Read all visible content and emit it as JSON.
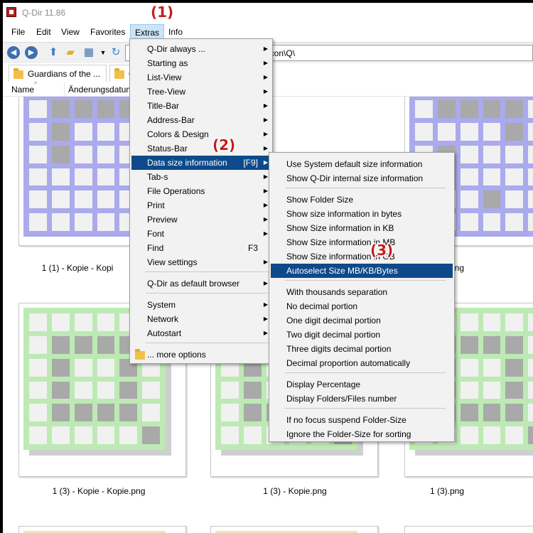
{
  "window": {
    "title": "Q-Dir 11.86"
  },
  "menubar": {
    "items": [
      "File",
      "Edit",
      "View",
      "Favorites",
      "Extras",
      "Info"
    ]
  },
  "address": {
    "path": "g\\icon\\Q\\"
  },
  "tabs": [
    {
      "label": "Guardians of the ..."
    },
    {
      "label": "C"
    }
  ],
  "columns": {
    "name": "Name",
    "date": "Änderungsdatum"
  },
  "thumbnails": [
    {
      "caption": "1 (1) - Kopie - Kopi",
      "color": "#aaaaec"
    },
    {
      "caption": "",
      "color": "#aaaaec"
    },
    {
      "caption": "1 (1).png",
      "color": "#aaaaec"
    },
    {
      "caption": "1 (3) - Kopie - Kopie.png",
      "color": "#bdeab4"
    },
    {
      "caption": "1 (3) - Kopie.png",
      "color": "#bdeab4"
    },
    {
      "caption": "1 (3).png",
      "color": "#bdeab4"
    }
  ],
  "extras_menu": {
    "items": [
      {
        "label": "Q-Dir always ...",
        "submenu": true
      },
      {
        "label": "Starting as",
        "submenu": true
      },
      {
        "label": "List-View",
        "submenu": true
      },
      {
        "label": "Tree-View",
        "submenu": true
      },
      {
        "label": "Title-Bar",
        "submenu": true
      },
      {
        "label": "Address-Bar",
        "submenu": true
      },
      {
        "label": "Colors & Design",
        "submenu": true
      },
      {
        "label": "Status-Bar",
        "submenu": true
      },
      {
        "label": "Data size information",
        "shortcut": "[F9]",
        "submenu": true,
        "highlighted": true
      },
      {
        "label": "Tab-s",
        "submenu": true
      },
      {
        "label": "File Operations",
        "submenu": true
      },
      {
        "label": "Print",
        "submenu": true
      },
      {
        "label": "Preview",
        "submenu": true
      },
      {
        "label": "Font",
        "submenu": true
      },
      {
        "label": "Find",
        "shortcut": "F3"
      },
      {
        "label": "View settings",
        "submenu": true
      },
      {
        "label": "Q-Dir as default browser",
        "submenu": true
      },
      {
        "label": "System",
        "submenu": true
      },
      {
        "label": "Network",
        "submenu": true
      },
      {
        "label": "Autostart",
        "submenu": true
      },
      {
        "label": "... more options"
      }
    ]
  },
  "size_menu": {
    "items": [
      {
        "label": "Use System default size information"
      },
      {
        "label": "Show Q-Dir internal size information"
      },
      {
        "label": "Show Folder Size"
      },
      {
        "label": "Show size information in bytes"
      },
      {
        "label": "Show Size information in KB"
      },
      {
        "label": "Show Size information in MB"
      },
      {
        "label": "Show Size information in GB"
      },
      {
        "label": "Autoselect Size MB/KB/Bytes",
        "highlighted": true
      },
      {
        "label": "With thousands separation"
      },
      {
        "label": "No decimal portion"
      },
      {
        "label": "One digit decimal portion"
      },
      {
        "label": "Two digit decimal portion"
      },
      {
        "label": "Three digits decimal portion"
      },
      {
        "label": "Decimal proportion automatically"
      },
      {
        "label": "Display Percentage"
      },
      {
        "label": "Display Folders/Files number"
      },
      {
        "label": "If no focus suspend Folder-Size"
      },
      {
        "label": "Ignore the Folder-Size for sorting"
      }
    ]
  },
  "annotations": [
    "(1)",
    "(2)",
    "(3)"
  ],
  "colors": {
    "menu_highlight": "#0e4a8a",
    "annotation": "#c41e1e"
  }
}
